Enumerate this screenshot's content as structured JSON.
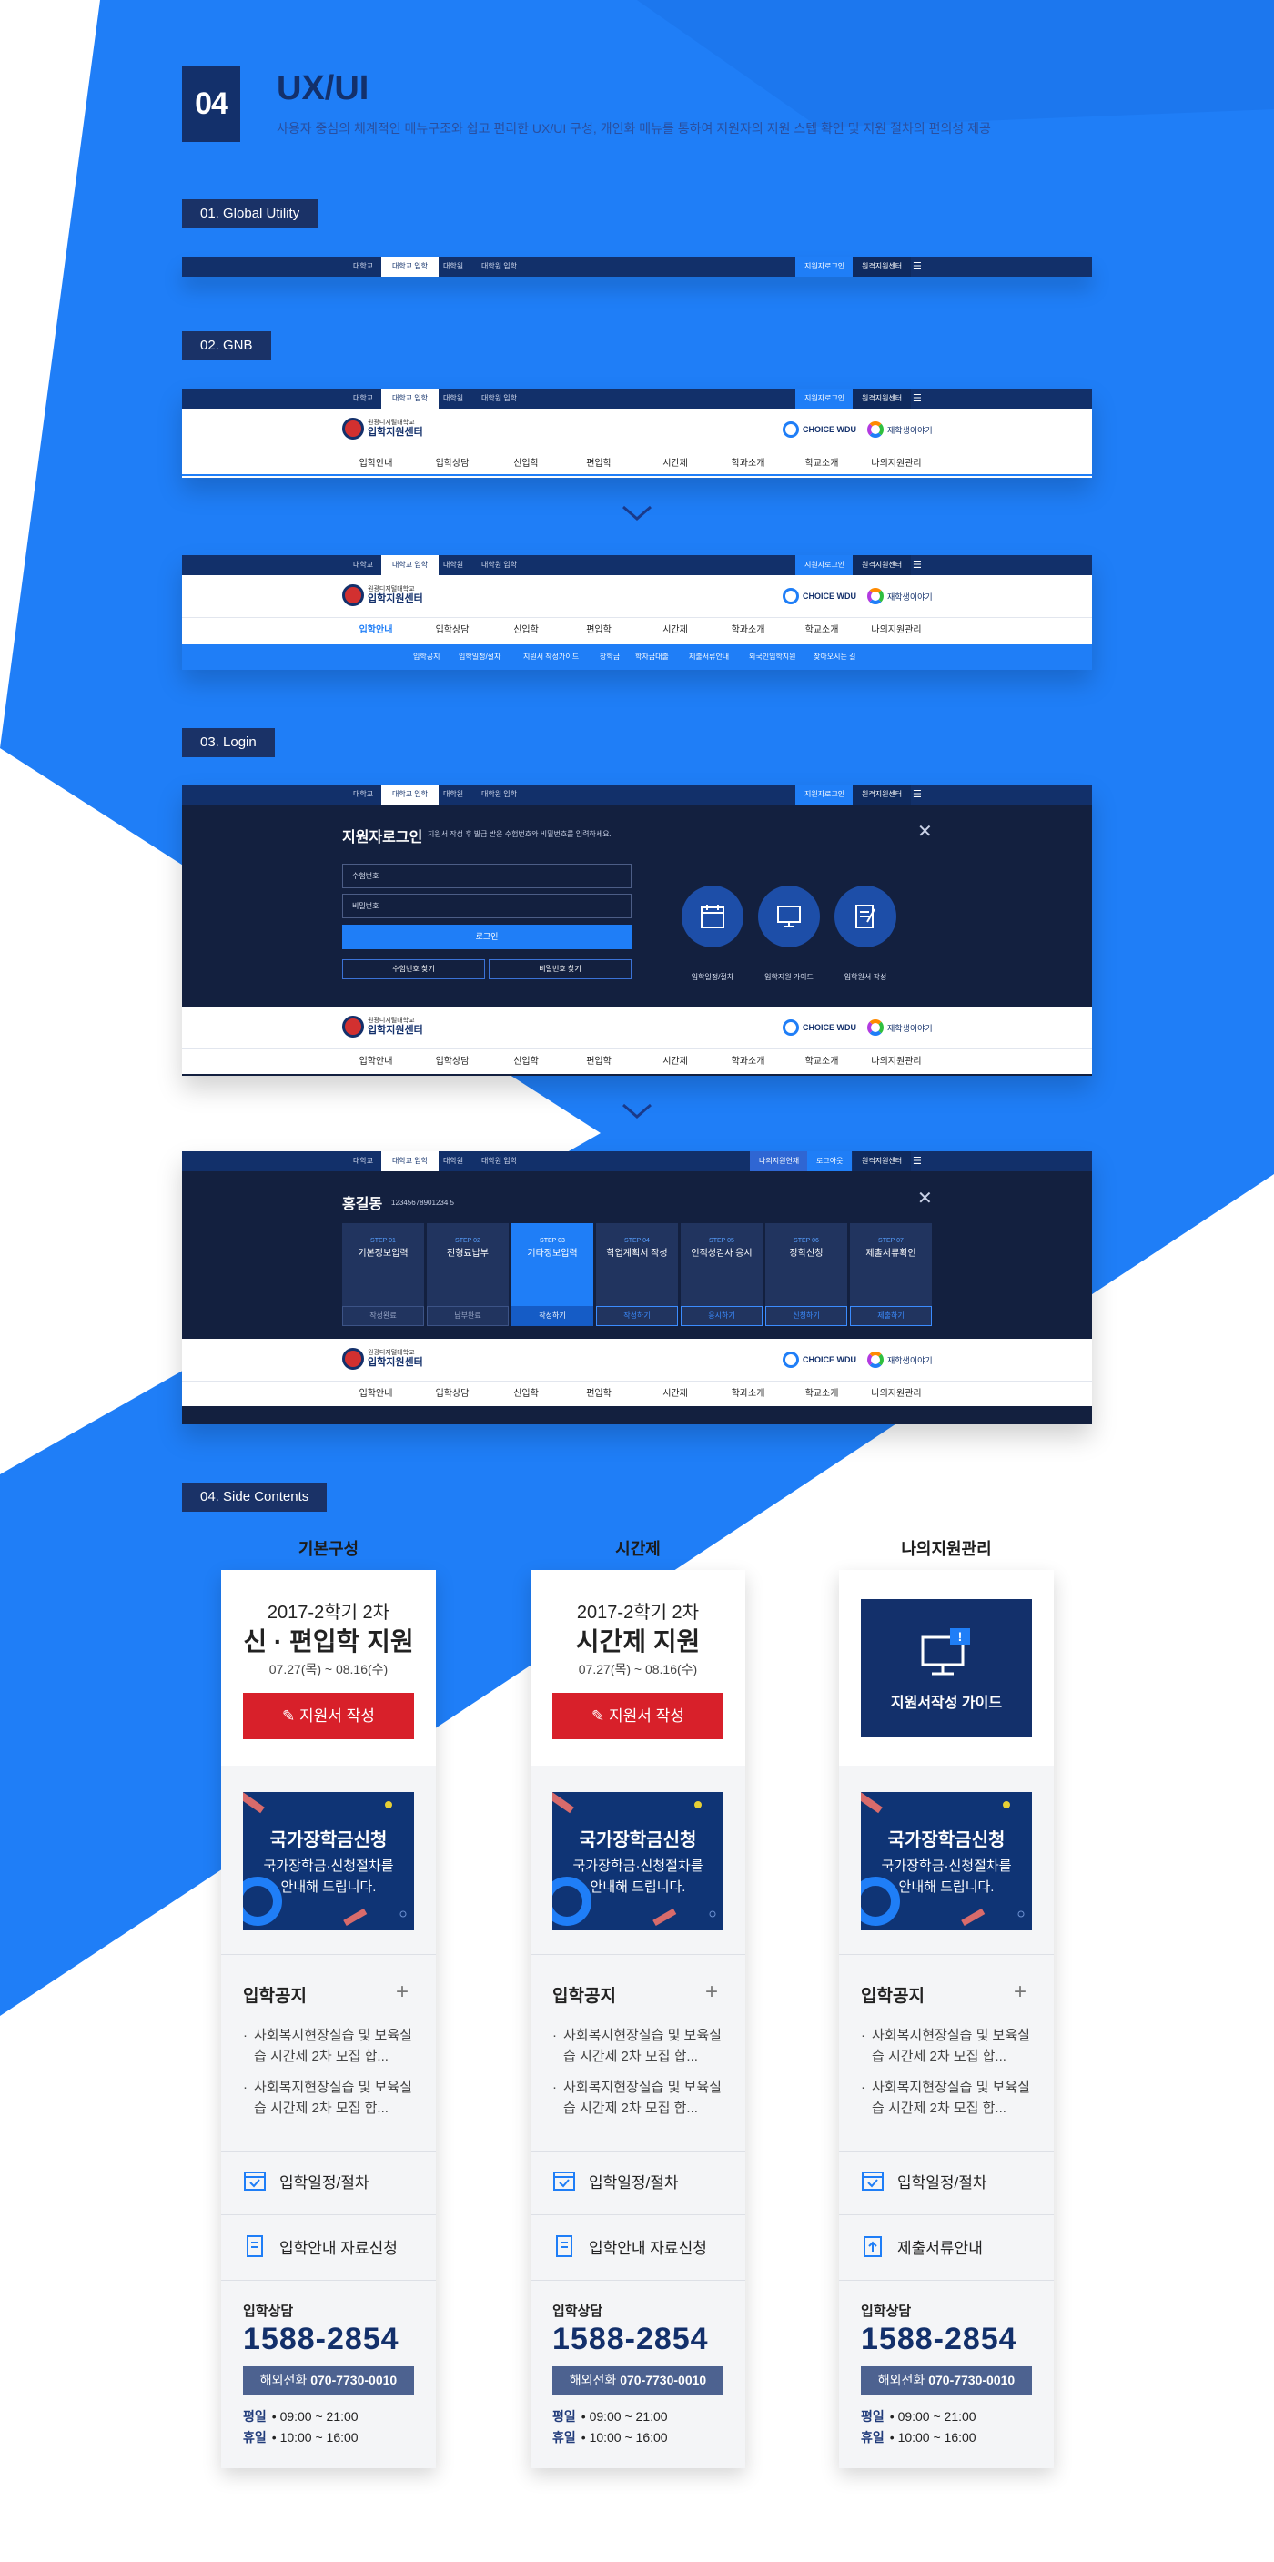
{
  "section": {
    "number": "04",
    "title": "UX/UI",
    "description": "사용자 중심의 체계적인 메뉴구조와 쉽고 편리한 UX/UI 구성, 개인화 메뉴를 통하여 지원자의 지원 스텝 확인 및 지원 절차의 편의성 제공"
  },
  "labels": {
    "global_utility": "01. Global Utility",
    "gnb": "02. GNB",
    "login": "03. Login",
    "side_contents": "04. Side Contents"
  },
  "utility": {
    "tabs": [
      "대학교",
      "대학교 입학",
      "대학원",
      "대학원 입학"
    ],
    "active_tab": 1,
    "applicant_login": "지원자로그인",
    "admission_center": "원격지원센터",
    "my_application": "나의지원현재",
    "logout": "로그아웃"
  },
  "brand": {
    "logo_small": "원광디지털대학교",
    "logo_big": "입학지원센터",
    "choice": "CHOICE WDU",
    "story": "재학생이야기"
  },
  "gnb": {
    "menu": [
      "입학안내",
      "입학상담",
      "신입학",
      "편입학",
      "시간제",
      "학과소개",
      "학교소개",
      "나의지원관리"
    ],
    "submenu": [
      "입학공지",
      "입학일정/절차",
      "지원서 작성가이드",
      "장학금",
      "학자금대출",
      "제출서류안내",
      "외국인입학지원",
      "찾아오시는 길"
    ]
  },
  "login": {
    "title": "지원자로그인",
    "subtitle": "지원서 작성 후 발급 받은 수험번호와 비밀번호를 입력하세요.",
    "exam_number_placeholder": "수험번호",
    "password_placeholder": "비밀번호",
    "login_button": "로그인",
    "find_number": "수험번호 찾기",
    "find_password": "비밀번호 찾기",
    "shortcuts": [
      "입학일정/절차",
      "입학지원 가이드",
      "입학원서 작성"
    ]
  },
  "loggedin": {
    "name": "홍길동",
    "exam_number": "12345678901234 5",
    "steps": [
      {
        "step": "STEP 01",
        "name": "기본정보입력",
        "action": "작성완료"
      },
      {
        "step": "STEP 02",
        "name": "전형료납부",
        "action": "납부완료"
      },
      {
        "step": "STEP 03",
        "name": "기타정보입력",
        "action": "작성하기"
      },
      {
        "step": "STEP 04",
        "name": "학업계획서 작성",
        "action": "작성하기"
      },
      {
        "step": "STEP 05",
        "name": "인적성검사 응시",
        "action": "응시하기"
      },
      {
        "step": "STEP 06",
        "name": "장학신청",
        "action": "신청하기"
      },
      {
        "step": "STEP 07",
        "name": "제출서류확인",
        "action": "제출하기"
      }
    ]
  },
  "side": {
    "columns": [
      "기본구성",
      "시간제",
      "나의지원관리"
    ],
    "cards": [
      {
        "term": "2017-2학기 2차",
        "title": "신 · 편입학 지원",
        "date": "07.27(목) ~ 08.16(수)",
        "apply": "지원서 작성",
        "links": [
          "입학일정/절차",
          "입학안내 자료신청"
        ]
      },
      {
        "term": "2017-2학기 2차",
        "title": "시간제 지원",
        "date": "07.27(목) ~ 08.16(수)",
        "apply": "지원서 작성",
        "links": [
          "입학일정/절차",
          "입학안내 자료신청"
        ]
      },
      {
        "guide": "지원서작성 가이드",
        "links": [
          "입학일정/절차",
          "제출서류안내"
        ]
      }
    ],
    "banner_title": "국가장학금신청",
    "banner_sub1": "국가장학금·신청절차를",
    "banner_sub2": "안내해 드립니다.",
    "notice_title": "입학공지",
    "notices": [
      "사회복지현장실습 및 보육실습 시간제 2차 모집 합...",
      "사회복지현장실습 및 보육실습 시간제 2차 모집 합..."
    ],
    "consult_title": "입학상담",
    "phone": "1588-2854",
    "intl_label": "해외전화",
    "intl_number": "070-7730-0010",
    "weekday_label": "평일",
    "weekday_hours": "09:00 ~ 21:00",
    "holiday_label": "휴일",
    "holiday_hours": "10:00 ~ 16:00"
  },
  "colors": {
    "navy": "#13306b",
    "blue": "#1f7ef7",
    "red": "#d8202a",
    "dark": "#13203f"
  }
}
